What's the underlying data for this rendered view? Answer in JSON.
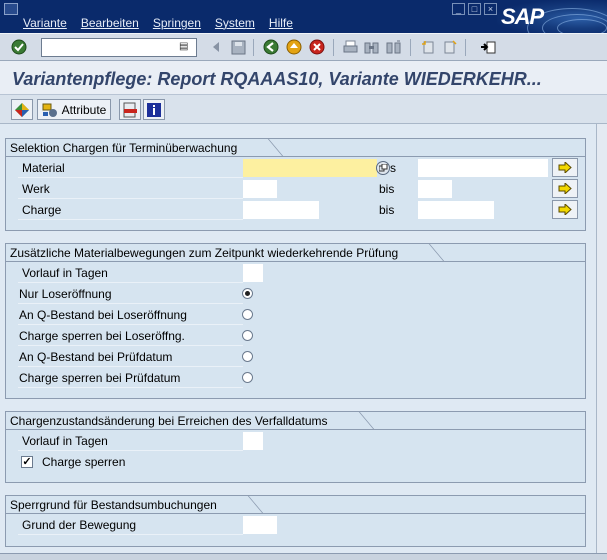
{
  "menubar": {
    "items": [
      "Variante",
      "Bearbeiten",
      "Springen",
      "System",
      "Hilfe"
    ],
    "window_buttons": [
      "_",
      "□",
      "×"
    ],
    "logo": "SAP"
  },
  "toolbar": {
    "command_value": "",
    "history_glyph": "▤",
    "icons": [
      "enter-icon",
      "back-arrow-icon",
      "save-icon",
      "back-icon",
      "exit-icon",
      "cancel-icon",
      "print-icon",
      "find-icon",
      "find-next-icon",
      "first-page-icon",
      "last-page-icon",
      "new-session-icon"
    ]
  },
  "title": "Variantenpflege: Report RQAAAS10, Variante WIEDERKEHR...",
  "appbar": {
    "attribute_label": "Attribute"
  },
  "frames": {
    "selektion": {
      "title": "Selektion Chargen für Terminüberwachung",
      "bis_label": "bis",
      "rows": [
        {
          "label": "Material",
          "value_from": "",
          "value_to": ""
        },
        {
          "label": "Werk",
          "value_from": "",
          "value_to": ""
        },
        {
          "label": "Charge",
          "value_from": "",
          "value_to": ""
        }
      ]
    },
    "zusaetzlich": {
      "title": "Zusätzliche Materialbewegungen zum Zeitpunkt wiederkehrende Prüfung",
      "vorlauf_label": "Vorlauf in Tagen",
      "vorlauf_value": "",
      "options": [
        {
          "label": "Nur Loseröffnung",
          "selected": true
        },
        {
          "label": "An Q-Bestand bei Loseröffnung",
          "selected": false
        },
        {
          "label": "Charge sperren bei Loseröffng.",
          "selected": false
        },
        {
          "label": "An Q-Bestand bei Prüfdatum",
          "selected": false
        },
        {
          "label": "Charge sperren bei Prüfdatum",
          "selected": false
        }
      ]
    },
    "zustand": {
      "title": "Chargenzustandsänderung bei Erreichen des Verfalldatums",
      "vorlauf_label": "Vorlauf in Tagen",
      "vorlauf_value": "",
      "check_label": "Charge sperren",
      "checked": true
    },
    "sperrgrund": {
      "title": "Sperrgrund für Bestandsumbuchungen",
      "grund_label": "Grund der Bewegung",
      "grund_value": ""
    }
  }
}
